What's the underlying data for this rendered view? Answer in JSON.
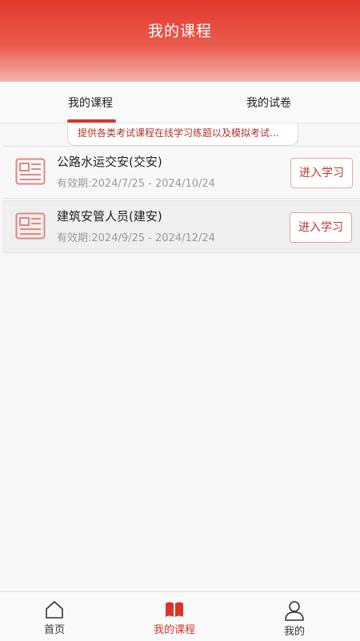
{
  "header": {
    "title": "我的课程"
  },
  "tabs": [
    {
      "label": "我的课程",
      "active": true
    },
    {
      "label": "我的试卷",
      "active": false
    }
  ],
  "notice": "提供各类考试课程在线学习练题以及模拟考试...",
  "courses": [
    {
      "name": "公路水运交安(交安)",
      "validity": "有效期:2024/7/25 - 2024/10/24",
      "button": "进入学习"
    },
    {
      "name": "建筑安管人员(建安)",
      "validity": "有效期:2024/9/25 - 2024/12/24",
      "button": "进入学习"
    }
  ],
  "bottom_nav": [
    {
      "label": "首页",
      "icon": "home-icon",
      "active": false
    },
    {
      "label": "我的课程",
      "icon": "book-icon",
      "active": true
    },
    {
      "label": "我的",
      "icon": "user-icon",
      "active": false
    }
  ],
  "colors": {
    "accent": "#d8352a",
    "header_top": "#e23a2d"
  }
}
